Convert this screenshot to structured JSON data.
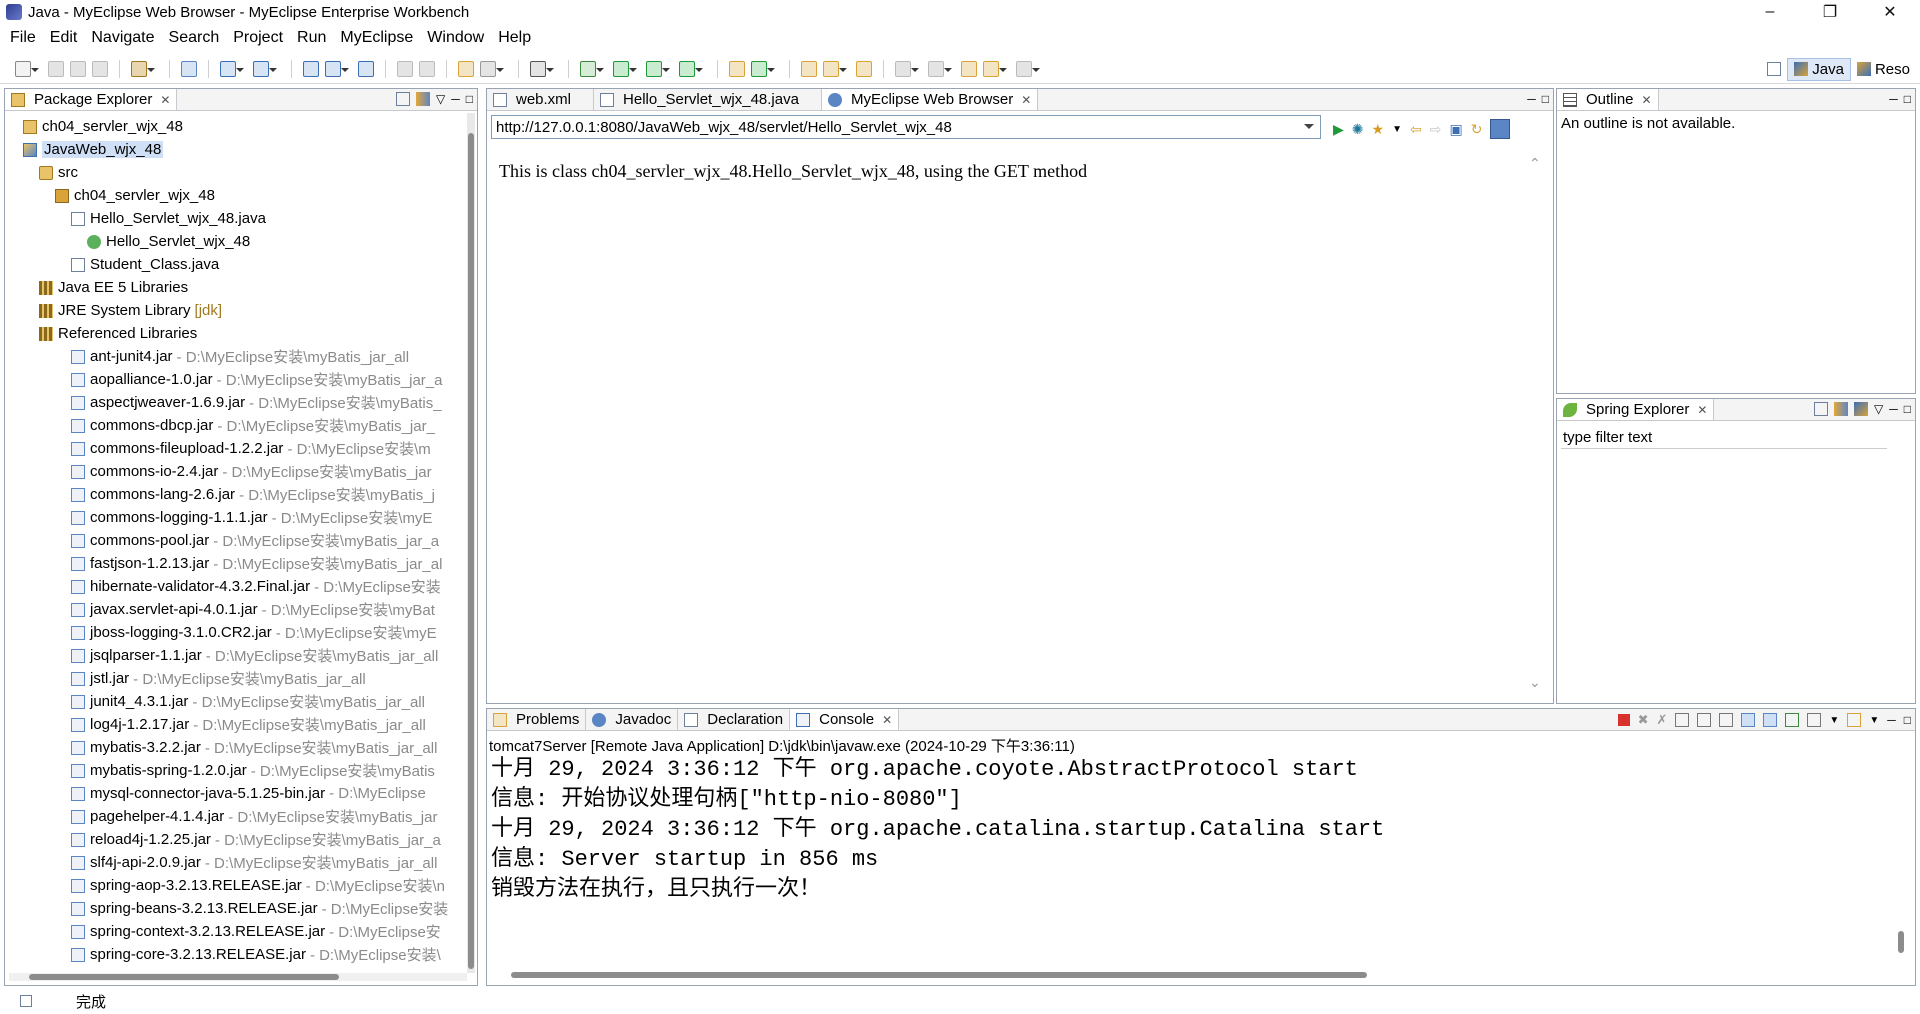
{
  "window": {
    "title": "Java - MyEclipse Web Browser - MyEclipse Enterprise Workbench"
  },
  "menu": [
    "File",
    "Edit",
    "Navigate",
    "Search",
    "Project",
    "Run",
    "MyEclipse",
    "Window",
    "Help"
  ],
  "perspectives": [
    {
      "label": "Java",
      "active": true
    },
    {
      "label": "Reso",
      "active": false
    }
  ],
  "package_explorer": {
    "tab": "Package Explorer",
    "tree": [
      {
        "label": "ch04_servler_wjx_48",
        "indent": 0,
        "icon": "project-icon"
      },
      {
        "label": "JavaWeb_wjx_48",
        "indent": 0,
        "icon": "web-project-icon",
        "selected": true
      },
      {
        "label": "src",
        "indent": 1,
        "icon": "source-folder-icon"
      },
      {
        "label": "ch04_servler_wjx_48",
        "indent": 2,
        "icon": "package-icon"
      },
      {
        "label": "Hello_Servlet_wjx_48.java",
        "indent": 3,
        "icon": "java-file-icon"
      },
      {
        "label": "Hello_Servlet_wjx_48",
        "indent": 4,
        "icon": "class-icon"
      },
      {
        "label": "Student_Class.java",
        "indent": 3,
        "icon": "java-file-icon"
      },
      {
        "label": "Java EE 5 Libraries",
        "indent": 1,
        "icon": "library-icon"
      },
      {
        "label": "JRE System Library",
        "indent": 1,
        "icon": "library-icon",
        "suffix": "[jdk]"
      },
      {
        "label": "Referenced Libraries",
        "indent": 1,
        "icon": "library-icon"
      }
    ],
    "jars": [
      {
        "name": "ant-junit4.jar",
        "path": " - D:\\MyEclipse安装\\myBatis_jar_all"
      },
      {
        "name": "aopalliance-1.0.jar",
        "path": " - D:\\MyEclipse安装\\myBatis_jar_a"
      },
      {
        "name": "aspectjweaver-1.6.9.jar",
        "path": " - D:\\MyEclipse安装\\myBatis_"
      },
      {
        "name": "commons-dbcp.jar",
        "path": " - D:\\MyEclipse安装\\myBatis_jar_"
      },
      {
        "name": "commons-fileupload-1.2.2.jar",
        "path": " - D:\\MyEclipse安装\\m"
      },
      {
        "name": "commons-io-2.4.jar",
        "path": " - D:\\MyEclipse安装\\myBatis_jar"
      },
      {
        "name": "commons-lang-2.6.jar",
        "path": " - D:\\MyEclipse安装\\myBatis_j"
      },
      {
        "name": "commons-logging-1.1.1.jar",
        "path": " - D:\\MyEclipse安装\\myE"
      },
      {
        "name": "commons-pool.jar",
        "path": " - D:\\MyEclipse安装\\myBatis_jar_a"
      },
      {
        "name": "fastjson-1.2.13.jar",
        "path": " - D:\\MyEclipse安装\\myBatis_jar_al"
      },
      {
        "name": "hibernate-validator-4.3.2.Final.jar",
        "path": " - D:\\MyEclipse安装"
      },
      {
        "name": "javax.servlet-api-4.0.1.jar",
        "path": " - D:\\MyEclipse安装\\myBat"
      },
      {
        "name": "jboss-logging-3.1.0.CR2.jar",
        "path": " - D:\\MyEclipse安装\\myE"
      },
      {
        "name": "jsqlparser-1.1.jar",
        "path": " - D:\\MyEclipse安装\\myBatis_jar_all"
      },
      {
        "name": "jstl.jar",
        "path": " - D:\\MyEclipse安装\\myBatis_jar_all"
      },
      {
        "name": "junit4_4.3.1.jar",
        "path": " - D:\\MyEclipse安装\\myBatis_jar_all"
      },
      {
        "name": "log4j-1.2.17.jar",
        "path": " - D:\\MyEclipse安装\\myBatis_jar_all"
      },
      {
        "name": "mybatis-3.2.2.jar",
        "path": " - D:\\MyEclipse安装\\myBatis_jar_all"
      },
      {
        "name": "mybatis-spring-1.2.0.jar",
        "path": " - D:\\MyEclipse安装\\myBatis"
      },
      {
        "name": "mysql-connector-java-5.1.25-bin.jar",
        "path": " - D:\\MyEclipse"
      },
      {
        "name": "pagehelper-4.1.4.jar",
        "path": " - D:\\MyEclipse安装\\myBatis_jar"
      },
      {
        "name": "reload4j-1.2.25.jar",
        "path": " - D:\\MyEclipse安装\\myBatis_jar_a"
      },
      {
        "name": "slf4j-api-2.0.9.jar",
        "path": " - D:\\MyEclipse安装\\myBatis_jar_all"
      },
      {
        "name": "spring-aop-3.2.13.RELEASE.jar",
        "path": " - D:\\MyEclipse安装\\n"
      },
      {
        "name": "spring-beans-3.2.13.RELEASE.jar",
        "path": " - D:\\MyEclipse安装"
      },
      {
        "name": "spring-context-3.2.13.RELEASE.jar",
        "path": " - D:\\MyEclipse安"
      },
      {
        "name": "spring-core-3.2.13.RELEASE.jar",
        "path": " - D:\\MyEclipse安装\\"
      }
    ]
  },
  "editor": {
    "tabs": [
      {
        "label": "web.xml",
        "active": false
      },
      {
        "label": "Hello_Servlet_wjx_48.java",
        "active": false
      },
      {
        "label": "MyEclipse Web Browser",
        "active": true
      }
    ],
    "url": "http://127.0.0.1:8080/JavaWeb_wjx_48/servlet/Hello_Servlet_wjx_48",
    "content": "This is class ch04_servler_wjx_48.Hello_Servlet_wjx_48, using the GET method"
  },
  "outline": {
    "tab": "Outline",
    "message": "An outline is not available."
  },
  "spring_explorer": {
    "tab": "Spring Explorer",
    "filter_placeholder": "type filter text"
  },
  "console": {
    "tabs": [
      {
        "label": "Problems",
        "active": false
      },
      {
        "label": "Javadoc",
        "active": false
      },
      {
        "label": "Declaration",
        "active": false
      },
      {
        "label": "Console",
        "active": true
      }
    ],
    "header": "tomcat7Server [Remote Java Application] D:\\jdk\\bin\\javaw.exe (2024-10-29 下午3:36:11)",
    "lines": [
      "十月 29, 2024 3:36:12 下午 org.apache.coyote.AbstractProtocol start",
      "信息: 开始协议处理句柄[\"http-nio-8080\"]",
      "十月 29, 2024 3:36:12 下午 org.apache.catalina.startup.Catalina start",
      "信息: Server startup in 856 ms",
      "销毁方法在执行，且只执行一次！"
    ]
  },
  "status": {
    "text": "完成"
  },
  "colors": {
    "accent": "#3b6fb6",
    "selection": "#cfdff5",
    "stop": "#d9312b"
  }
}
